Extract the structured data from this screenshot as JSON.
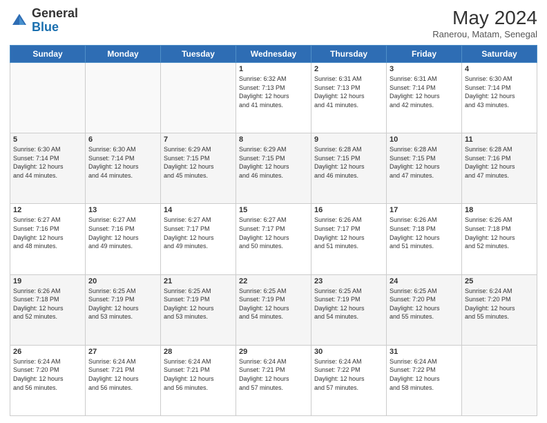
{
  "header": {
    "logo_general": "General",
    "logo_blue": "Blue",
    "month_year": "May 2024",
    "location": "Ranerou, Matam, Senegal"
  },
  "days_of_week": [
    "Sunday",
    "Monday",
    "Tuesday",
    "Wednesday",
    "Thursday",
    "Friday",
    "Saturday"
  ],
  "weeks": [
    [
      {
        "day": "",
        "info": ""
      },
      {
        "day": "",
        "info": ""
      },
      {
        "day": "",
        "info": ""
      },
      {
        "day": "1",
        "info": "Sunrise: 6:32 AM\nSunset: 7:13 PM\nDaylight: 12 hours\nand 41 minutes."
      },
      {
        "day": "2",
        "info": "Sunrise: 6:31 AM\nSunset: 7:13 PM\nDaylight: 12 hours\nand 41 minutes."
      },
      {
        "day": "3",
        "info": "Sunrise: 6:31 AM\nSunset: 7:14 PM\nDaylight: 12 hours\nand 42 minutes."
      },
      {
        "day": "4",
        "info": "Sunrise: 6:30 AM\nSunset: 7:14 PM\nDaylight: 12 hours\nand 43 minutes."
      }
    ],
    [
      {
        "day": "5",
        "info": "Sunrise: 6:30 AM\nSunset: 7:14 PM\nDaylight: 12 hours\nand 44 minutes."
      },
      {
        "day": "6",
        "info": "Sunrise: 6:30 AM\nSunset: 7:14 PM\nDaylight: 12 hours\nand 44 minutes."
      },
      {
        "day": "7",
        "info": "Sunrise: 6:29 AM\nSunset: 7:15 PM\nDaylight: 12 hours\nand 45 minutes."
      },
      {
        "day": "8",
        "info": "Sunrise: 6:29 AM\nSunset: 7:15 PM\nDaylight: 12 hours\nand 46 minutes."
      },
      {
        "day": "9",
        "info": "Sunrise: 6:28 AM\nSunset: 7:15 PM\nDaylight: 12 hours\nand 46 minutes."
      },
      {
        "day": "10",
        "info": "Sunrise: 6:28 AM\nSunset: 7:15 PM\nDaylight: 12 hours\nand 47 minutes."
      },
      {
        "day": "11",
        "info": "Sunrise: 6:28 AM\nSunset: 7:16 PM\nDaylight: 12 hours\nand 47 minutes."
      }
    ],
    [
      {
        "day": "12",
        "info": "Sunrise: 6:27 AM\nSunset: 7:16 PM\nDaylight: 12 hours\nand 48 minutes."
      },
      {
        "day": "13",
        "info": "Sunrise: 6:27 AM\nSunset: 7:16 PM\nDaylight: 12 hours\nand 49 minutes."
      },
      {
        "day": "14",
        "info": "Sunrise: 6:27 AM\nSunset: 7:17 PM\nDaylight: 12 hours\nand 49 minutes."
      },
      {
        "day": "15",
        "info": "Sunrise: 6:27 AM\nSunset: 7:17 PM\nDaylight: 12 hours\nand 50 minutes."
      },
      {
        "day": "16",
        "info": "Sunrise: 6:26 AM\nSunset: 7:17 PM\nDaylight: 12 hours\nand 51 minutes."
      },
      {
        "day": "17",
        "info": "Sunrise: 6:26 AM\nSunset: 7:18 PM\nDaylight: 12 hours\nand 51 minutes."
      },
      {
        "day": "18",
        "info": "Sunrise: 6:26 AM\nSunset: 7:18 PM\nDaylight: 12 hours\nand 52 minutes."
      }
    ],
    [
      {
        "day": "19",
        "info": "Sunrise: 6:26 AM\nSunset: 7:18 PM\nDaylight: 12 hours\nand 52 minutes."
      },
      {
        "day": "20",
        "info": "Sunrise: 6:25 AM\nSunset: 7:19 PM\nDaylight: 12 hours\nand 53 minutes."
      },
      {
        "day": "21",
        "info": "Sunrise: 6:25 AM\nSunset: 7:19 PM\nDaylight: 12 hours\nand 53 minutes."
      },
      {
        "day": "22",
        "info": "Sunrise: 6:25 AM\nSunset: 7:19 PM\nDaylight: 12 hours\nand 54 minutes."
      },
      {
        "day": "23",
        "info": "Sunrise: 6:25 AM\nSunset: 7:19 PM\nDaylight: 12 hours\nand 54 minutes."
      },
      {
        "day": "24",
        "info": "Sunrise: 6:25 AM\nSunset: 7:20 PM\nDaylight: 12 hours\nand 55 minutes."
      },
      {
        "day": "25",
        "info": "Sunrise: 6:24 AM\nSunset: 7:20 PM\nDaylight: 12 hours\nand 55 minutes."
      }
    ],
    [
      {
        "day": "26",
        "info": "Sunrise: 6:24 AM\nSunset: 7:20 PM\nDaylight: 12 hours\nand 56 minutes."
      },
      {
        "day": "27",
        "info": "Sunrise: 6:24 AM\nSunset: 7:21 PM\nDaylight: 12 hours\nand 56 minutes."
      },
      {
        "day": "28",
        "info": "Sunrise: 6:24 AM\nSunset: 7:21 PM\nDaylight: 12 hours\nand 56 minutes."
      },
      {
        "day": "29",
        "info": "Sunrise: 6:24 AM\nSunset: 7:21 PM\nDaylight: 12 hours\nand 57 minutes."
      },
      {
        "day": "30",
        "info": "Sunrise: 6:24 AM\nSunset: 7:22 PM\nDaylight: 12 hours\nand 57 minutes."
      },
      {
        "day": "31",
        "info": "Sunrise: 6:24 AM\nSunset: 7:22 PM\nDaylight: 12 hours\nand 58 minutes."
      },
      {
        "day": "",
        "info": ""
      }
    ]
  ]
}
